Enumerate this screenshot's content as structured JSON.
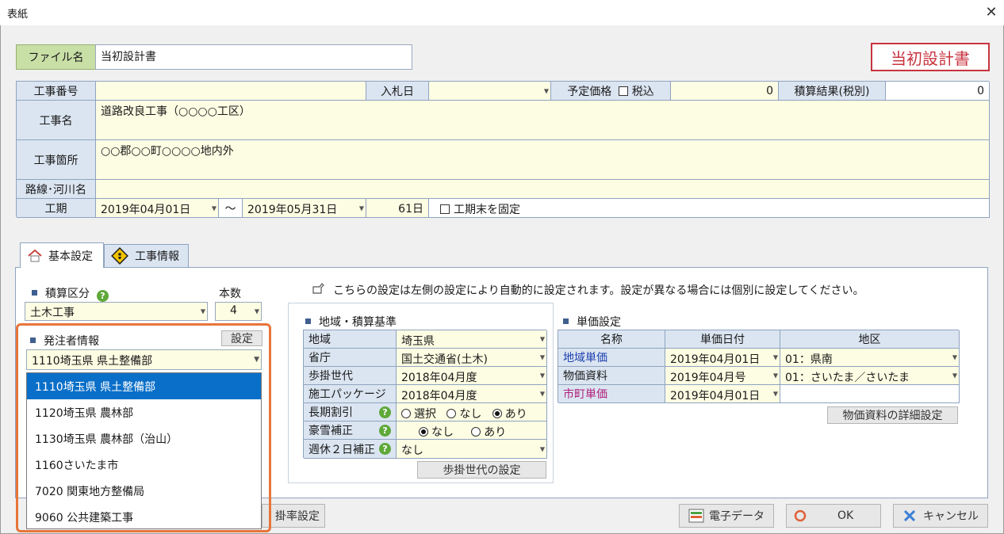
{
  "window": {
    "title": "表紙"
  },
  "file": {
    "label": "ファイル名",
    "value": "当初設計書",
    "badge": "当初設計書"
  },
  "header": {
    "kouji_bango": "工事番号",
    "nyusatsu_bi": "入札日",
    "yotei_kakaku": "予定価格",
    "zeikomi": "税込",
    "yotei_value": "0",
    "sekisan_kekka": "積算結果(税別)",
    "sekisan_value": "0",
    "kouji_mei_label": "工事名",
    "kouji_mei_value": "道路改良工事（○○○○工区）",
    "kouji_kasho_label": "工事箇所",
    "kouji_kasho_value": "○○郡○○町○○○○地内外",
    "rosen_label": "路線･河川名",
    "kouki_label": "工期",
    "start_date": "2019年04月01日",
    "tilde": "～",
    "end_date": "2019年05月31日",
    "days": "61日",
    "fix_end": "工期末を固定"
  },
  "tabs": [
    {
      "label": "基本設定"
    },
    {
      "label": "工事情報"
    }
  ],
  "basic": {
    "sekisan_kubun": "積算区分",
    "honsu": "本数",
    "kubun_value": "土木工事",
    "honsu_value": "4",
    "hatchu_label": "発注者情報",
    "settei_btn": "設定",
    "hatchu_value": "1110埼玉県 県土整備部",
    "note": "こちらの設定は左側の設定により自動的に設定されます。設定が異なる場合には個別に設定してください。",
    "kakeritsu_btn": "掛率設定"
  },
  "dropdown_options": [
    "1110埼玉県 県土整備部",
    "1120埼玉県 農林部",
    "1130埼玉県 農林部（治山）",
    "1160さいたま市",
    "7020 関東地方整備局",
    "9060 公共建築工事"
  ],
  "region": {
    "title": "地域・積算基準",
    "rows": [
      {
        "label": "地域",
        "value": "埼玉県"
      },
      {
        "label": "省庁",
        "value": "国土交通省(土木)"
      },
      {
        "label": "歩掛世代",
        "value": "2018年04月度"
      },
      {
        "label": "施工パッケージ",
        "value": "2018年04月度"
      }
    ],
    "choki_label": "長期割引",
    "choki_opts": [
      "選択",
      "なし",
      "あり"
    ],
    "gosetsu_label": "豪雪補正",
    "gosetsu_opts": [
      "なし",
      "あり"
    ],
    "shukyu_label": "週休２日補正",
    "shukyu_value": "なし",
    "bukake_btn": "歩掛世代の設定"
  },
  "unit": {
    "title": "単価設定",
    "headers": [
      "名称",
      "単価日付",
      "地区"
    ],
    "rows": [
      {
        "name": "地域単価",
        "date": "2019年04月01日",
        "area": "01：県南",
        "color": "#1c3fae"
      },
      {
        "name": "物価資料",
        "date": "2019年04月号",
        "area": "01：さいたま／さいたま",
        "color": "#1a1a1a"
      },
      {
        "name": "市町単価",
        "date": "2019年04月01日",
        "area": "",
        "color": "#b0207a"
      }
    ],
    "detail_btn": "物価資料の詳細設定"
  },
  "footer": {
    "denshi": "電子データ",
    "ok": "OK",
    "cancel": "キャンセル"
  }
}
